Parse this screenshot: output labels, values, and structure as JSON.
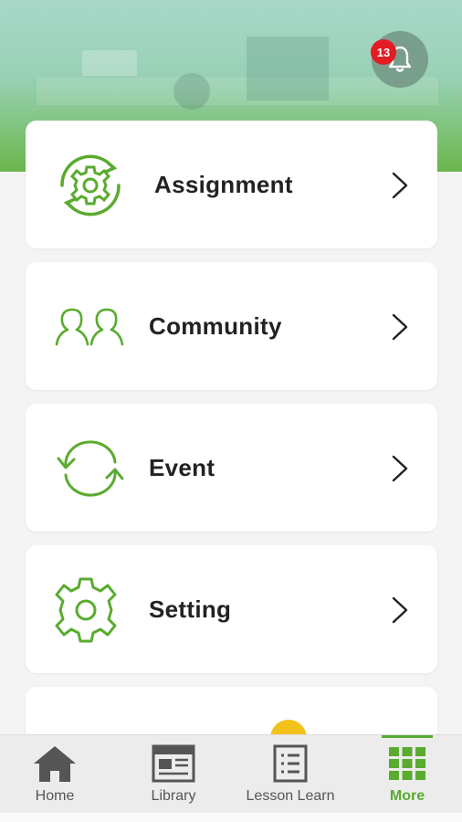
{
  "notification": {
    "count": "13",
    "icon": "bell-icon"
  },
  "menu": [
    {
      "label": "Assignment",
      "icon": "assignment-cycle-gear-icon"
    },
    {
      "label": "Community",
      "icon": "community-people-icon"
    },
    {
      "label": "Event",
      "icon": "event-refresh-icon"
    },
    {
      "label": "Setting",
      "icon": "settings-gear-icon"
    }
  ],
  "tabs": [
    {
      "label": "Home",
      "icon": "home-icon"
    },
    {
      "label": "Library",
      "icon": "library-icon"
    },
    {
      "label": "Lesson Learn",
      "icon": "lesson-list-icon"
    },
    {
      "label": "More",
      "icon": "grid-icon",
      "active": true
    }
  ],
  "colors": {
    "accent": "#5aab2f",
    "badge": "#e31b23"
  }
}
